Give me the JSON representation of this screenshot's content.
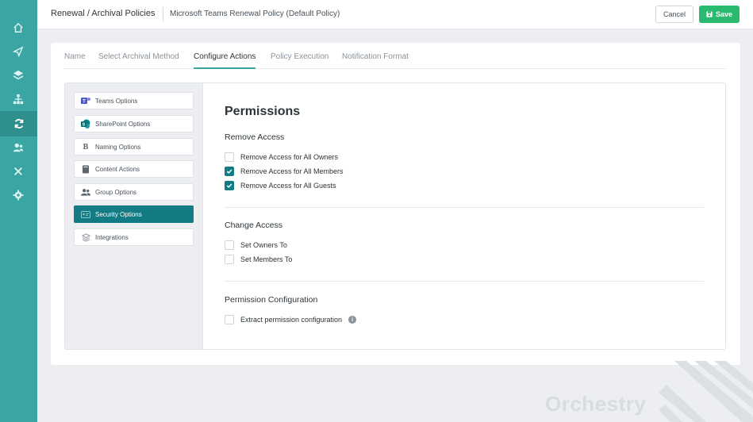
{
  "header": {
    "breadcrumb": "Renewal / Archival Policies",
    "subtitle": "Microsoft Teams Renewal Policy (Default Policy)",
    "cancel_label": "Cancel",
    "save_label": "Save"
  },
  "nav_icons": [
    "home-icon",
    "send-icon",
    "layers-icon",
    "hierarchy-icon",
    "refresh-icon",
    "users-icon",
    "tools-icon",
    "gear-icon"
  ],
  "tabs": [
    {
      "label": "Name"
    },
    {
      "label": "Select Archival Method"
    },
    {
      "label": "Configure Actions",
      "active": true
    },
    {
      "label": "Policy Execution"
    },
    {
      "label": "Notification Format"
    }
  ],
  "sidebar": {
    "items": [
      {
        "label": "Teams Options",
        "icon": "teams-icon"
      },
      {
        "label": "SharePoint Options",
        "icon": "sharepoint-icon"
      },
      {
        "label": "Naming Options",
        "icon": "bold-b-icon"
      },
      {
        "label": "Content Actions",
        "icon": "book-icon"
      },
      {
        "label": "Group Options",
        "icon": "group-icon"
      },
      {
        "label": "Security Options",
        "icon": "id-card-icon",
        "active": true
      },
      {
        "label": "Integrations",
        "icon": "layers-icon"
      }
    ]
  },
  "permissions": {
    "title": "Permissions",
    "remove_access": {
      "heading": "Remove Access",
      "options": [
        {
          "label": "Remove Access for All Owners",
          "checked": false
        },
        {
          "label": "Remove Access for All Members",
          "checked": true
        },
        {
          "label": "Remove Access for All Guests",
          "checked": true
        }
      ]
    },
    "change_access": {
      "heading": "Change Access",
      "options": [
        {
          "label": "Set Owners To",
          "checked": false
        },
        {
          "label": "Set Members To",
          "checked": false
        }
      ]
    },
    "permission_configuration": {
      "heading": "Permission Configuration",
      "options": [
        {
          "label": "Extract permission configuration",
          "checked": false
        }
      ]
    }
  },
  "watermark": "Orchestry",
  "colors": {
    "rail": "#3aa6a3",
    "accent": "#137b83",
    "save": "#29ba6f"
  }
}
